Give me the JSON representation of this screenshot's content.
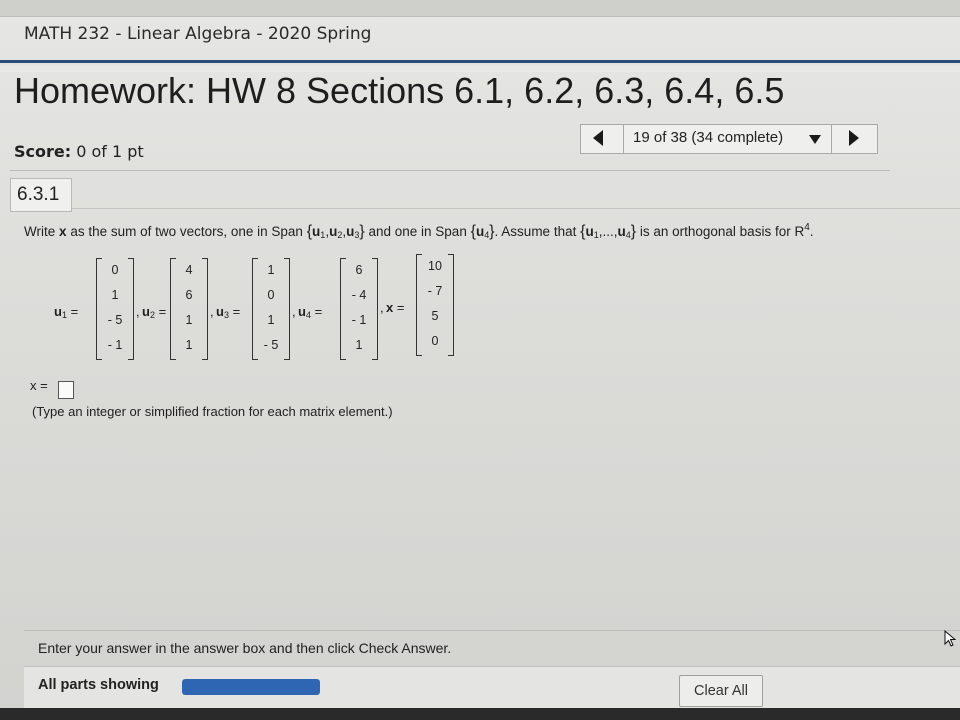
{
  "course": {
    "title": "MATH 232 - Linear Algebra - 2020 Spring"
  },
  "homework": {
    "title": "Homework: HW 8 Sections 6.1, 6.2, 6.3, 6.4, 6.5"
  },
  "score": {
    "label": "Score:",
    "value": "0 of 1 pt"
  },
  "navigation": {
    "position": "19 of 38 (34 complete)"
  },
  "section": {
    "number": "6.3.1"
  },
  "question": {
    "write": "Write",
    "x": "x",
    "part1": "as the sum of two vectors, one in Span",
    "span1_open": "{",
    "span1_vecs": [
      {
        "name": "u",
        "sub": "1"
      },
      {
        "name": "u",
        "sub": "2"
      },
      {
        "name": "u",
        "sub": "3"
      }
    ],
    "span1_close": "}",
    "part2": "and one in Span",
    "span2_open": "{",
    "span2_name": "u",
    "span2_sub": "4",
    "span2_close": "}",
    "part3": ". Assume that",
    "basis_open": "{",
    "basis_first_name": "u",
    "basis_first_sub": "1",
    "basis_dots": ",...,",
    "basis_last_name": "u",
    "basis_last_sub": "4",
    "basis_close": "}",
    "part4": "is an orthogonal basis for",
    "space": "R",
    "space_sup": "4",
    "end": "."
  },
  "vectors": [
    {
      "label": "u",
      "sub": "1",
      "suffix": " =",
      "values": [
        "0",
        "1",
        "- 5",
        "- 1"
      ]
    },
    {
      "label": "u",
      "sub": "2",
      "suffix": " =",
      "values": [
        "4",
        "6",
        "1",
        "1"
      ]
    },
    {
      "label": "u",
      "sub": "3",
      "suffix": " =",
      "values": [
        "1",
        "0",
        "1",
        "- 5"
      ]
    },
    {
      "label": "u",
      "sub": "4",
      "suffix": " =",
      "values": [
        "6",
        "- 4",
        "- 1",
        "1"
      ]
    },
    {
      "label": "x",
      "sub": "",
      "suffix": " =",
      "values": [
        "10",
        "- 7",
        "5",
        "0"
      ]
    }
  ],
  "separators": [
    ",",
    ",",
    ",",
    ","
  ],
  "answer": {
    "label": "x =",
    "hint": "(Type an integer or simplified fraction for each matrix element.)"
  },
  "footer": {
    "instruction": "Enter your answer in the answer box and then click Check Answer.",
    "parts_label": "All parts showing",
    "progress_fraction": 1.0,
    "clear_label": "Clear All"
  },
  "colors": {
    "accent": "#2c4d78",
    "progress": "#2f66b3"
  },
  "icons": {
    "prev": "triangle-left",
    "next": "triangle-right",
    "dropdown": "triangle-down",
    "cursor": "mouse-pointer"
  }
}
